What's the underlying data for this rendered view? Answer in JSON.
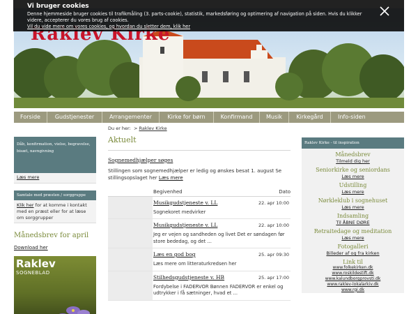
{
  "site": {
    "title": "Raklev Kirke"
  },
  "cookie": {
    "title": "Vi bruger cookies",
    "text": "Denne hjemmeside bruger cookies til trafikmåling (3. parts-cookie), statistik, markedsføring og optimering af navigation på siden. Hvis du klikker videre, accepterer du vores brug af cookies.",
    "link": "Vil du vide mere om vores cookies, og hvordan du sletter dem, klik her"
  },
  "nav": [
    "Forside",
    "Gudstjenester",
    "Arrangementer",
    "Kirke for børn",
    "Konfirmand",
    "Musik",
    "Kirkegård",
    "Info-siden"
  ],
  "breadcrumb": {
    "prefix": "Du er her:",
    "sep": ">",
    "current": "Raklev Kirke"
  },
  "left": {
    "box1_text": "Dåb, konfirmation, vielse, begravelse, bisæt, navngivning",
    "box1_link": "Læs mere",
    "box2_head": "Samtale med præsten / sorggruppe",
    "box2_link": "Klik her",
    "box2_text": "for at komme i kontakt med en præst eller for at læse om sorggrupper",
    "maned_title": "Månedsbrev for april",
    "download": "Download her",
    "cover_title": "Raklev",
    "cover_sub": "SOGNEBLAD"
  },
  "main": {
    "heading": "Aktuelt",
    "feature_title": "Sognemedhjælper søges",
    "feature_text": "Stillingen som sognemedhjælper er ledig og ønskes besat 1. august Se stillingsopslaget her",
    "feature_link": "Læs mere",
    "col_event": "Begivenhed",
    "col_date": "Dato",
    "events": [
      {
        "title": "Musikgudstjeneste v. LL",
        "time": "22. apr 10:00",
        "desc": "Sognekoret medvirker"
      },
      {
        "title": "Musikgudstjeneste v. LL",
        "time": "22. apr 10:00",
        "desc": "Jeg er vejen og sandheden og livet Det er søndagen før store bededag, og det ..."
      },
      {
        "title": "Læs en god bog",
        "time": "25. apr 09:30",
        "desc": "Læs mere om litteraturkredsen her"
      },
      {
        "title": "Stilhedsgudstjeneste v. HB",
        "time": "25. apr 17:00",
        "desc": "Fordybelse i FADERVOR Bønnen FADERVOR er enkel og udtrykker i få sætninger, hvad et ..."
      }
    ]
  },
  "right": {
    "head": "Raklev Kirke - til inspiration",
    "items": [
      {
        "title": "Månedsbrev",
        "link": "Tilmeld dig her"
      },
      {
        "title": "Seniorkirke og seniordans",
        "link": "Læs mere"
      },
      {
        "title": "Udstilling",
        "link": "Læs mere"
      },
      {
        "title": "Nørkleklub i sognehuset",
        "link": "Læs mere"
      },
      {
        "title": "Indsamling",
        "link": "Til ÅBNE DØRE"
      },
      {
        "title": "Retraitedage og meditation",
        "link": "Læs mere"
      },
      {
        "title": "Fotogalleri",
        "link": "Billeder af og fra kirken"
      }
    ],
    "links_title": "Link til",
    "links": [
      "www.folkekirken.dk",
      "www.roskildestift.dk",
      "www.kalundborgprovsti.dk",
      "www.raklev-lokalarkiv.dk",
      "www.rgi.dk"
    ]
  },
  "colors": {
    "accent_green": "#7a8a3a",
    "teal_box": "#5a7b80",
    "nav_bg": "#9c9a7f",
    "title_red": "#c8142a"
  }
}
